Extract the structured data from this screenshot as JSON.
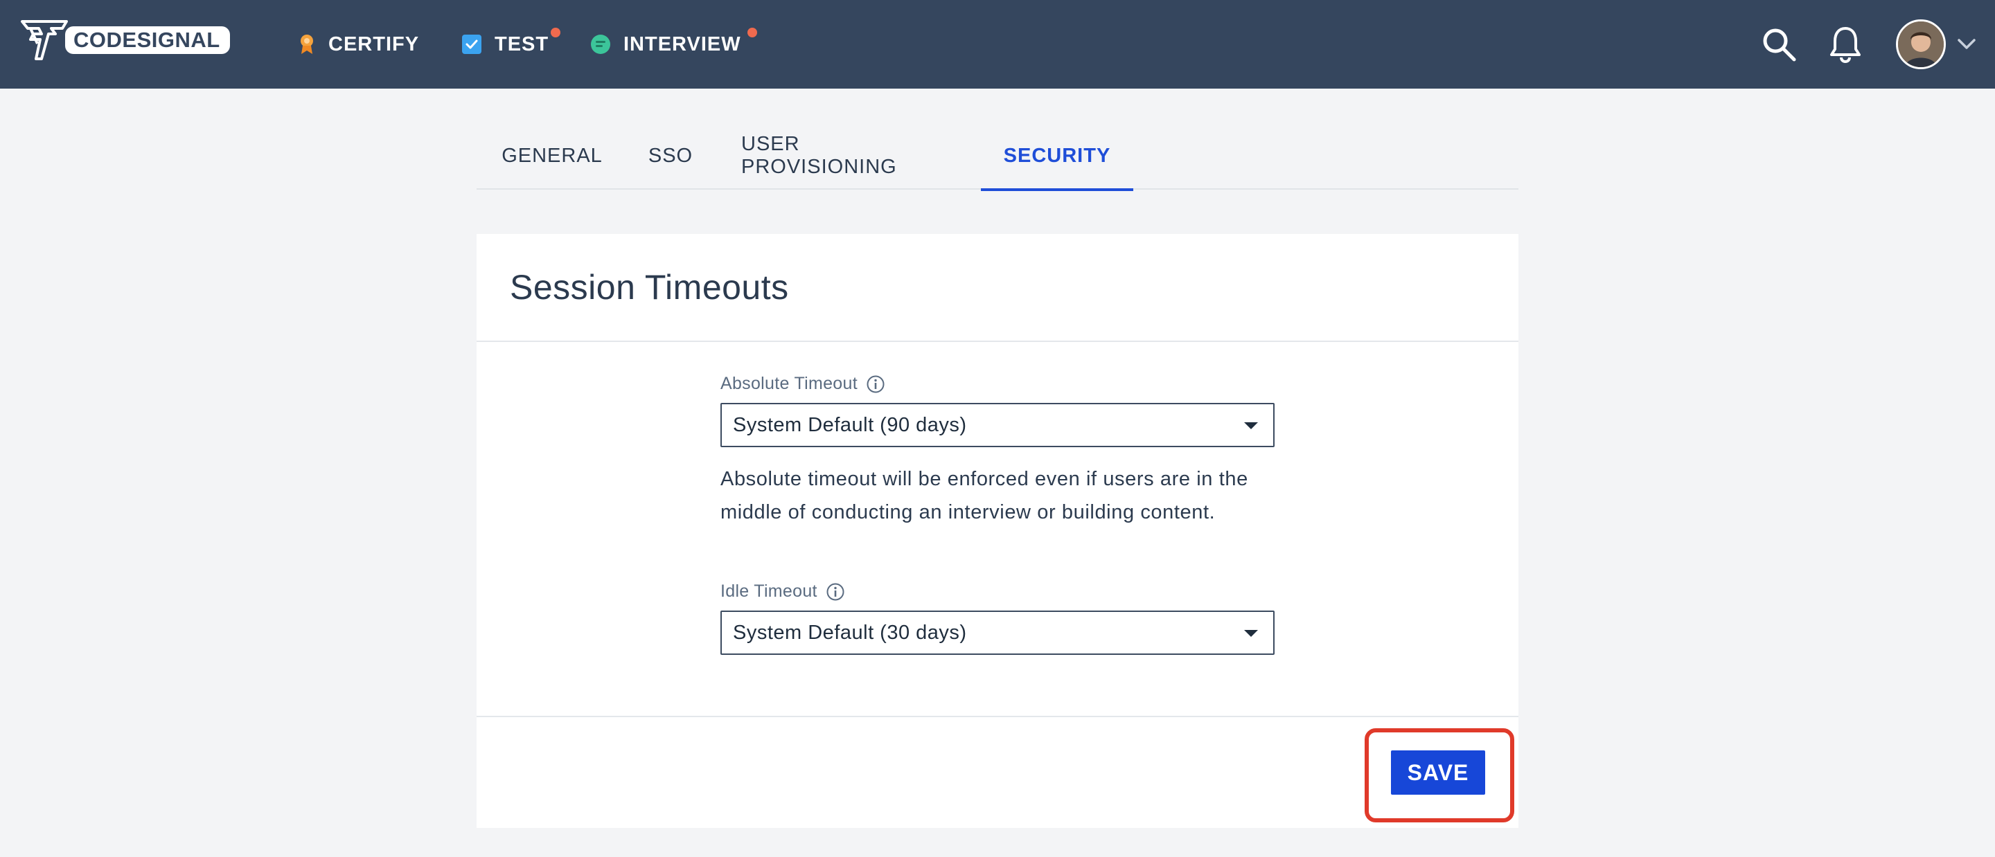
{
  "brand": {
    "logo_text": "CODESIGNAL"
  },
  "nav": {
    "items": [
      {
        "label": "CERTIFY",
        "icon": "certify-ribbon-icon",
        "has_notification": false
      },
      {
        "label": "TEST",
        "icon": "test-checkbox-icon",
        "has_notification": true
      },
      {
        "label": "INTERVIEW",
        "icon": "interview-chat-icon",
        "has_notification": true
      }
    ],
    "right_icons": [
      "search-icon",
      "bell-icon",
      "avatar",
      "chevron-down-icon"
    ]
  },
  "tabs": [
    {
      "label": "GENERAL",
      "active": false
    },
    {
      "label": "SSO",
      "active": false
    },
    {
      "label": "USER PROVISIONING",
      "active": false
    },
    {
      "label": "SECURITY",
      "active": true
    }
  ],
  "card": {
    "title": "Session Timeouts",
    "absolute_timeout": {
      "label": "Absolute Timeout",
      "value": "System Default (90 days)",
      "help": "Absolute timeout will be enforced even if users are in the middle of conducting an interview or building content."
    },
    "idle_timeout": {
      "label": "Idle Timeout",
      "value": "System Default (30 days)"
    },
    "save_label": "SAVE"
  },
  "colors": {
    "nav_bg": "#35465e",
    "accent": "#1f4ed8",
    "save_button": "#1747d8",
    "highlight": "#e03a2a",
    "notification_dot": "#f06a4e"
  }
}
